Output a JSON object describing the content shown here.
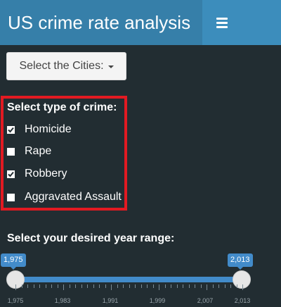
{
  "header": {
    "title": "US crime rate analysis",
    "menu_icon": "hamburger-icon",
    "brand_color": "#367fa9",
    "navbar_color": "#3c8dbc"
  },
  "sidebar": {
    "background": "#222d32",
    "city_selector": {
      "label": "Select the Cities:",
      "icon": "caret-down-icon"
    },
    "crime_filter": {
      "title": "Select type of crime:",
      "highlight_color": "#e21a22",
      "options": [
        {
          "label": "Homicide",
          "checked": true
        },
        {
          "label": "Rape",
          "checked": false
        },
        {
          "label": "Robbery",
          "checked": true
        },
        {
          "label": "Aggravated Assault",
          "checked": false
        }
      ]
    },
    "year_range": {
      "title": "Select your desired year range:",
      "min": 1975,
      "max": 2013,
      "from_label": "1,975",
      "to_label": "2,013",
      "tick_labels": [
        "1,975",
        "1,983",
        "1,991",
        "1,999",
        "2,007",
        "2,013"
      ],
      "accent_color": "#428bca"
    }
  }
}
